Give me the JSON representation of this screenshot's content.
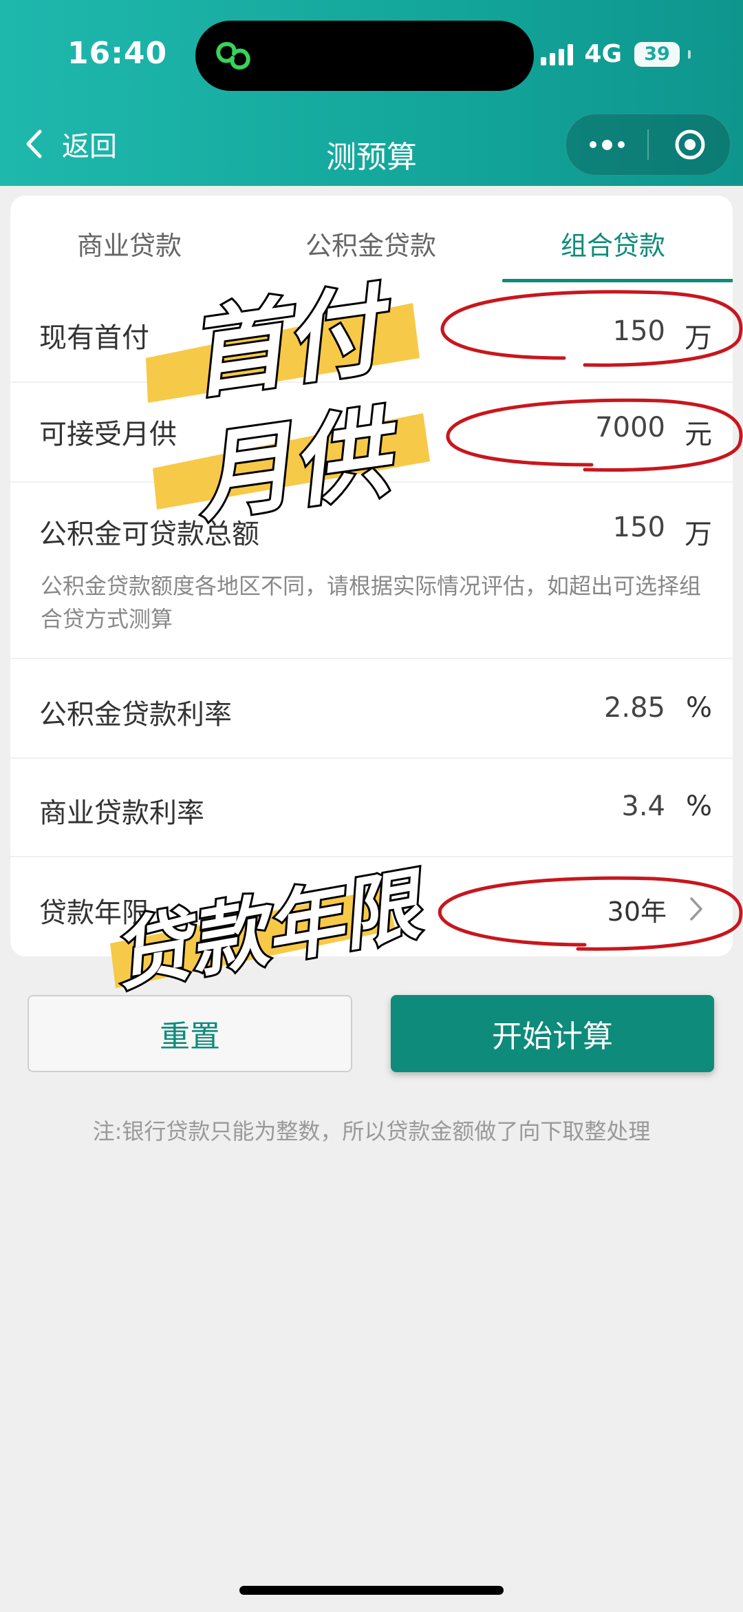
{
  "status_bar": {
    "time": "16:40",
    "network": "4G",
    "battery": "39"
  },
  "nav": {
    "back_label": "返回",
    "title": "测预算"
  },
  "tabs": [
    {
      "label": "商业贷款",
      "active": false
    },
    {
      "label": "公积金贷款",
      "active": false
    },
    {
      "label": "组合贷款",
      "active": true
    }
  ],
  "form": {
    "down_payment": {
      "label": "现有首付",
      "value": "150",
      "unit": "万"
    },
    "monthly_payment": {
      "label": "可接受月供",
      "value": "7000",
      "unit": "元"
    },
    "fund_total": {
      "label": "公积金可贷款总额",
      "value": "150",
      "unit": "万"
    },
    "fund_note": "公积金贷款额度各地区不同，请根据实际情况评估，如超出可选择组合贷方式测算",
    "fund_rate": {
      "label": "公积金贷款利率",
      "value": "2.85",
      "unit": "%"
    },
    "commercial_rate": {
      "label": "商业贷款利率",
      "value": "3.4",
      "unit": "%"
    },
    "loan_term": {
      "label": "贷款年限",
      "value": "30年"
    }
  },
  "buttons": {
    "reset": "重置",
    "calculate": "开始计算"
  },
  "footnote": "注:银行贷款只能为整数，所以贷款金额做了向下取整处理",
  "annotations": {
    "down_payment": "首付",
    "monthly": "月供",
    "term": "贷款年限"
  },
  "colors": {
    "header": "#14a79c",
    "accent": "#0e8b7a",
    "highlight": "#f7c948",
    "circle": "#c8161d"
  },
  "icons": [
    "back-chevron-icon",
    "more-dots-icon",
    "target-icon",
    "chevron-right-icon",
    "signal-icon",
    "battery-icon",
    "island-logo-icon"
  ]
}
